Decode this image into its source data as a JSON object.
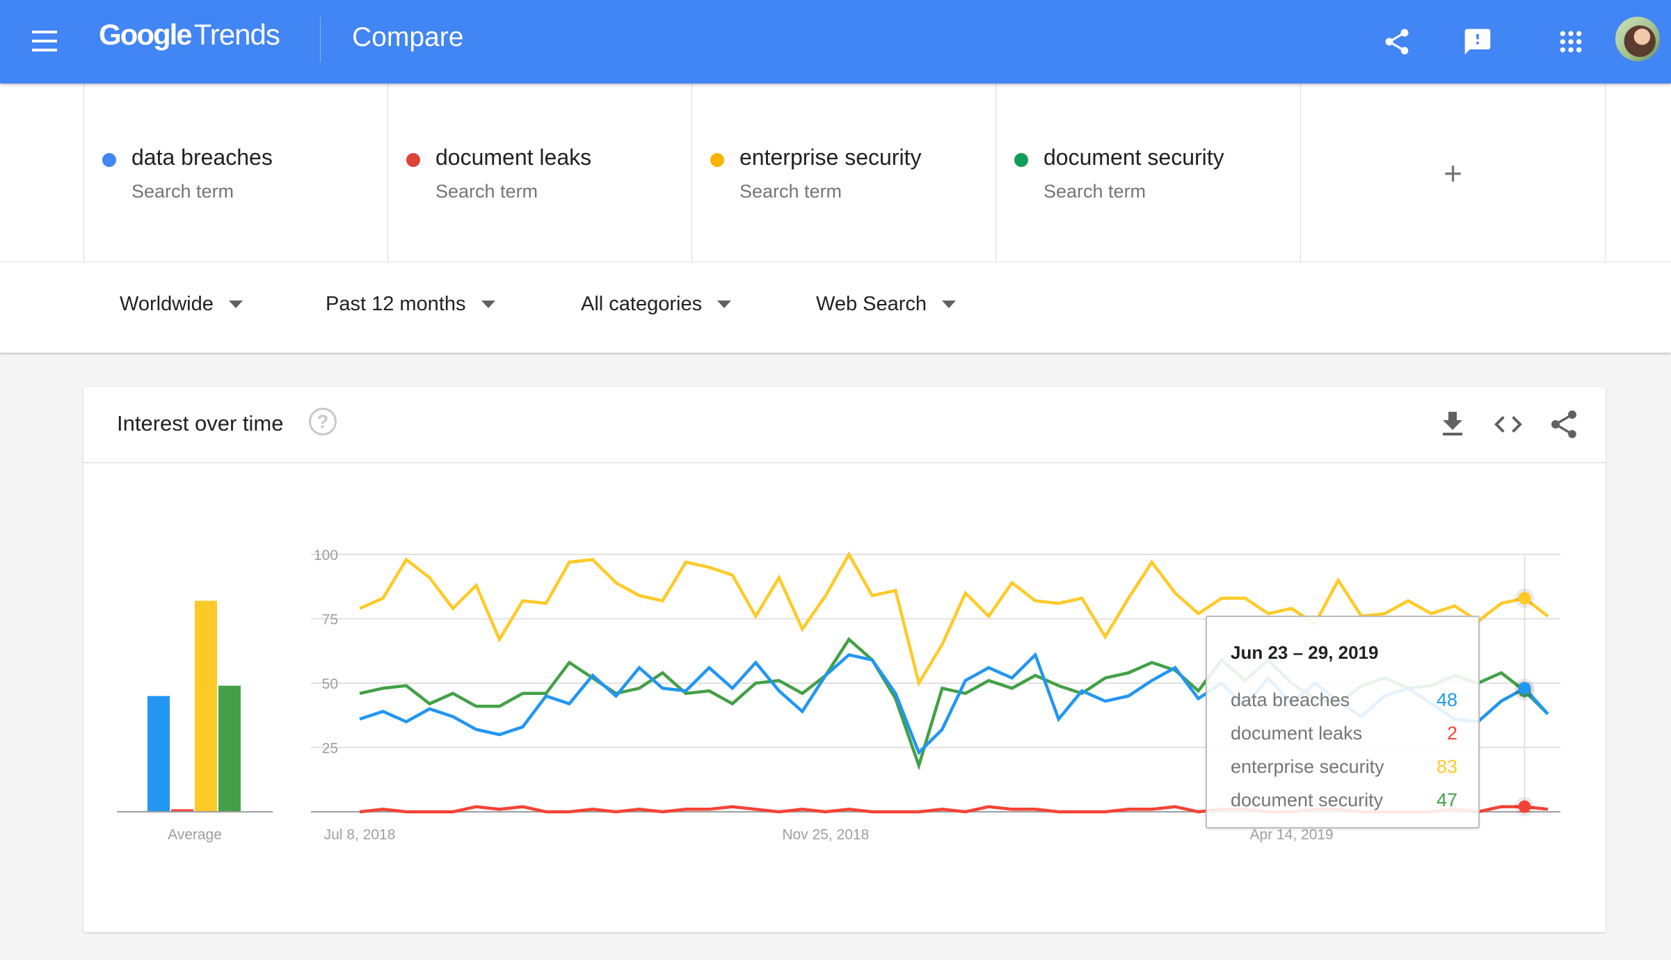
{
  "header": {
    "app_name_google": "Google",
    "app_name_trends": "Trends",
    "page_title": "Compare",
    "icons": [
      "menu-icon",
      "share-icon",
      "feedback-icon",
      "apps-grid-icon",
      "account-avatar"
    ]
  },
  "terms": [
    {
      "name": "data breaches",
      "type": "Search term",
      "color": "#4285f4"
    },
    {
      "name": "document leaks",
      "type": "Search term",
      "color": "#db4437"
    },
    {
      "name": "enterprise security",
      "type": "Search term",
      "color": "#f4b400"
    },
    {
      "name": "document security",
      "type": "Search term",
      "color": "#0f9d58"
    }
  ],
  "add_term_label": "+",
  "filters": {
    "region": "Worldwide",
    "time": "Past 12 months",
    "category": "All categories",
    "search_type": "Web Search"
  },
  "card": {
    "title": "Interest over time",
    "help_label": "?",
    "actions": [
      "download-icon",
      "embed-icon",
      "share-icon"
    ]
  },
  "tooltip": {
    "title": "Jun 23 – 29, 2019",
    "rows": [
      {
        "label": "data breaches",
        "value": "48",
        "color": "#2196f3"
      },
      {
        "label": "document leaks",
        "value": "2",
        "color": "#f44336"
      },
      {
        "label": "enterprise security",
        "value": "83",
        "color": "#ffca28"
      },
      {
        "label": "document security",
        "value": "47",
        "color": "#43a047"
      }
    ]
  },
  "chart_data": {
    "type": "line",
    "title": "Interest over time",
    "ylim": [
      0,
      100
    ],
    "yticks": [
      25,
      50,
      75,
      100
    ],
    "ytick_labels": [
      "25",
      "50",
      "75",
      "100"
    ],
    "x_labels": [
      {
        "index": 0,
        "label": "Jul 8, 2018"
      },
      {
        "index": 20,
        "label": "Nov 25, 2018"
      },
      {
        "index": 40,
        "label": "Apr 14, 2019"
      }
    ],
    "grid": true,
    "hover_index": 50,
    "average": {
      "label": "Average",
      "values": [
        45,
        1,
        82,
        49
      ]
    },
    "series": [
      {
        "name": "data breaches",
        "color": "#2196f3",
        "values": [
          36,
          39,
          35,
          40,
          37,
          32,
          30,
          33,
          45,
          42,
          53,
          45,
          56,
          48,
          47,
          56,
          48,
          58,
          47,
          39,
          53,
          61,
          59,
          46,
          23,
          32,
          51,
          56,
          52,
          61,
          36,
          47,
          43,
          45,
          51,
          56,
          44,
          50,
          41,
          52,
          42,
          50,
          43,
          37,
          45,
          48,
          42,
          36,
          35,
          43,
          48,
          38
        ]
      },
      {
        "name": "document leaks",
        "color": "#f44336",
        "values": [
          0,
          1,
          0,
          0,
          0,
          2,
          1,
          2,
          0,
          0,
          1,
          0,
          1,
          0,
          1,
          1,
          2,
          1,
          0,
          1,
          0,
          1,
          0,
          0,
          0,
          1,
          0,
          2,
          1,
          1,
          0,
          0,
          0,
          1,
          1,
          2,
          0,
          1,
          1,
          0,
          0,
          1,
          1,
          0,
          0,
          0,
          0,
          1,
          0,
          2,
          2,
          1
        ]
      },
      {
        "name": "enterprise security",
        "color": "#ffca28",
        "values": [
          79,
          83,
          98,
          91,
          79,
          88,
          67,
          82,
          81,
          97,
          98,
          89,
          84,
          82,
          97,
          95,
          92,
          76,
          91,
          71,
          84,
          100,
          84,
          86,
          50,
          65,
          85,
          76,
          89,
          82,
          81,
          83,
          68,
          83,
          97,
          85,
          77,
          83,
          83,
          77,
          79,
          73,
          90,
          76,
          77,
          82,
          77,
          80,
          74,
          81,
          83,
          76
        ]
      },
      {
        "name": "document security",
        "color": "#43a047",
        "values": [
          46,
          48,
          49,
          42,
          46,
          41,
          41,
          46,
          46,
          58,
          52,
          46,
          48,
          54,
          46,
          47,
          42,
          50,
          51,
          46,
          53,
          67,
          59,
          44,
          18,
          48,
          46,
          51,
          48,
          53,
          49,
          46,
          52,
          54,
          58,
          55,
          47,
          59,
          51,
          59,
          50,
          44,
          42,
          49,
          52,
          48,
          49,
          53,
          50,
          54,
          47,
          38
        ]
      }
    ]
  }
}
